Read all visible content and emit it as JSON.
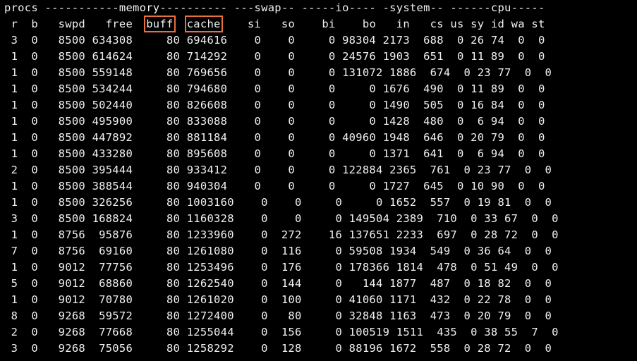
{
  "colors": {
    "background": "#000000",
    "text": "#f0f0f0",
    "highlight_box": "#e8703a"
  },
  "header": {
    "groups_line": "procs -----------memory---------- ---swap-- -----io---- -system-- ------cpu-----",
    "columns_line": {
      "before_buff": " r  b   swpd   free  ",
      "buff": "buff",
      "between": "  ",
      "cache": "cache",
      "after_cache": "    si   so    bi    bo   in   cs us sy id wa st"
    }
  },
  "rows": [
    " 3  0   8500 634308     80 694616    0    0     0 98304 2173  688  0 26 74  0  0",
    " 1  0   8500 614624     80 714292    0    0     0 24576 1903  651  0 11 89  0  0",
    " 1  0   8500 559148     80 769656    0    0     0 131072 1886  674  0 23 77  0  0",
    " 1  0   8500 534244     80 794680    0    0     0     0 1676  490  0 11 89  0  0",
    " 1  0   8500 502440     80 826608    0    0     0     0 1490  505  0 16 84  0  0",
    " 1  0   8500 495900     80 833088    0    0     0     0 1428  480  0  6 94  0  0",
    " 1  0   8500 447892     80 881184    0    0     0 40960 1948  646  0 20 79  0  0",
    " 1  0   8500 433280     80 895608    0    0     0     0 1371  641  0  6 94  0  0",
    " 2  0   8500 395444     80 933412    0    0     0 122884 2365  761  0 23 77  0  0",
    " 1  0   8500 388544     80 940304    0    0     0     0 1727  645  0 10 90  0  0",
    " 1  0   8500 326256     80 1003160    0    0     0     0 1652  557  0 19 81  0  0",
    " 3  0   8500 168824     80 1160328    0    0     0 149504 2389  710  0 33 67  0  0",
    " 1  0   8756  95876     80 1233960    0  272    16 137651 2233  697  0 28 72  0  0",
    " 7  0   8756  69160     80 1261080    0  116     0 59508 1934  549  0 36 64  0  0",
    " 1  0   9012  77756     80 1253496    0  176     0 178366 1814  478  0 51 49  0  0",
    " 5  0   9012  68860     80 1262540    0  144     0   144 1877  487  0 18 82  0  0",
    " 1  0   9012  70780     80 1261020    0  100     0 41060 1171  432  0 22 78  0  0",
    " 8  0   9268  59572     80 1272400    0   80     0 32848 1163  473  0 20 79  0  0",
    " 2  0   9268  77668     80 1255044    0  156     0 100519 1511  435  0 38 55  7  0",
    " 3  0   9268  75056     80 1258292    0  128     0 88196 1672  558  0 28 72  0  0"
  ]
}
